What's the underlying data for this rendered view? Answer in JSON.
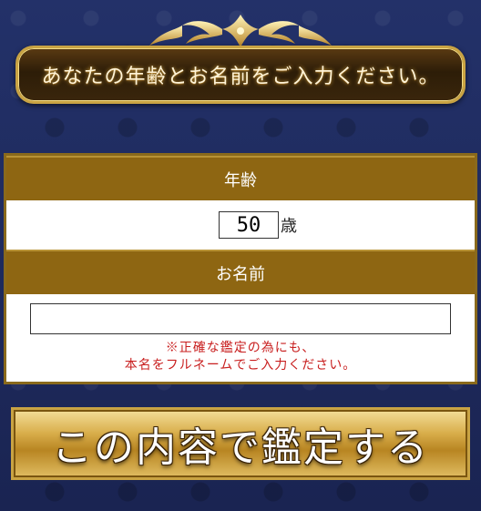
{
  "banner": {
    "title": "あなたの年齢とお名前をご入力ください。"
  },
  "form": {
    "age_header": "年齢",
    "age_value": "50",
    "age_unit": "歳",
    "name_header": "お名前",
    "name_value": "",
    "note_line1": "※正確な鑑定の為にも、",
    "note_line2": "本名をフルネームでご入力ください。"
  },
  "submit": {
    "label": "この内容で鑑定する"
  },
  "colors": {
    "background": "#1f2a5c",
    "section_header": "#8e6612",
    "gold": "#c9a343",
    "note": "#c81e1e"
  },
  "icons": {
    "ornament": "gold-flourish-ornament"
  }
}
